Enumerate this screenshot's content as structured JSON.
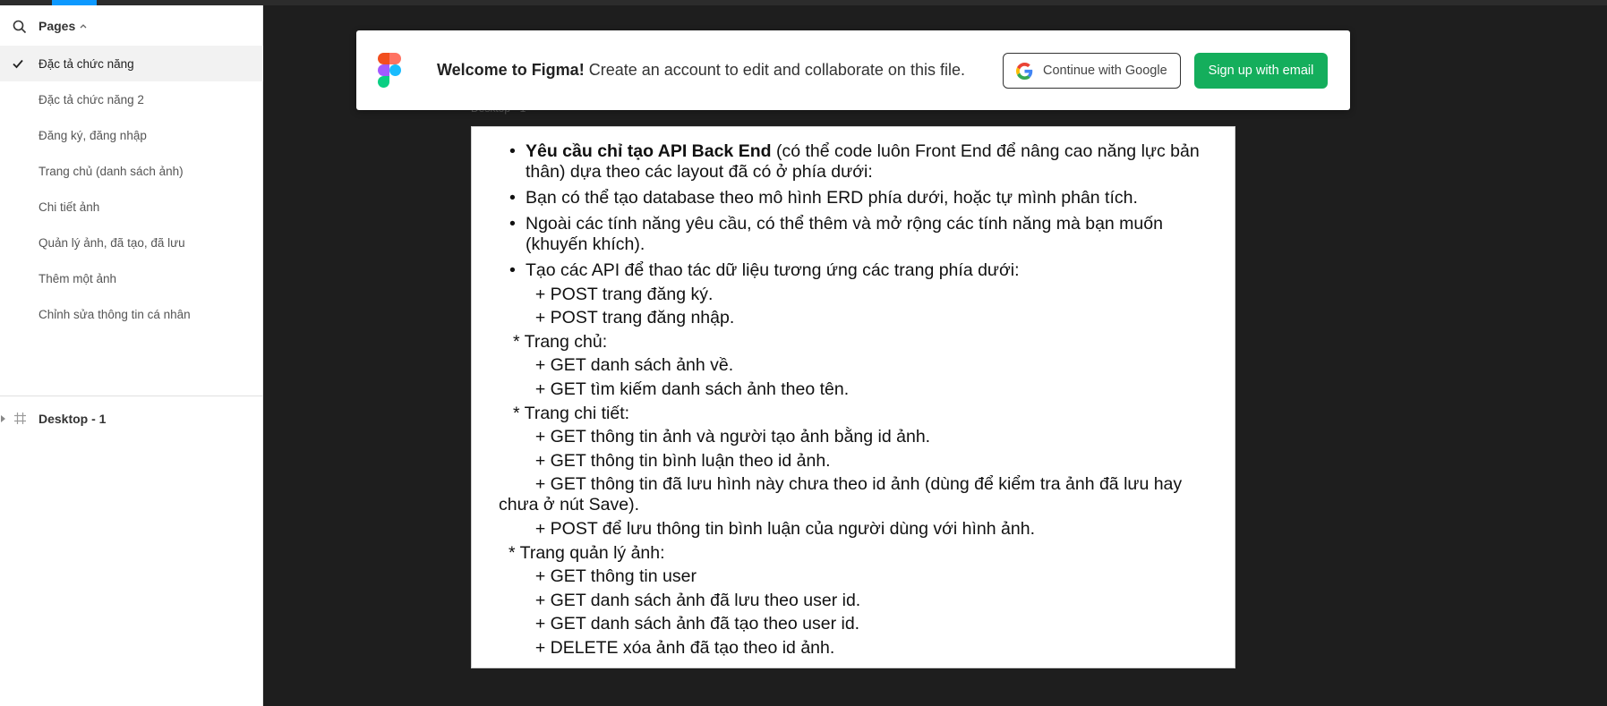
{
  "sidebar": {
    "pages_title": "Pages",
    "pages": [
      {
        "label": "Đặc tả chức năng",
        "active": true
      },
      {
        "label": "Đặc tả chức năng 2",
        "active": false
      },
      {
        "label": "Đăng ký, đăng nhập",
        "active": false
      },
      {
        "label": "Trang chủ (danh sách ảnh)",
        "active": false
      },
      {
        "label": "Chi tiết ảnh",
        "active": false
      },
      {
        "label": "Quản lý ảnh, đã tạo, đã lưu",
        "active": false
      },
      {
        "label": "Thêm một ảnh",
        "active": false
      },
      {
        "label": "Chỉnh sửa thông tin cá nhân",
        "active": false
      }
    ],
    "layers": [
      {
        "label": "Desktop - 1"
      }
    ]
  },
  "canvas": {
    "frame_label": "Desktop - 1"
  },
  "banner": {
    "welcome_bold": "Welcome to Figma!",
    "welcome_rest": " Create an account to edit and collaborate on this file.",
    "google_button": "Continue with Google",
    "signup_button": "Sign up with email"
  },
  "document": {
    "bullet1_bold": "Yêu cầu chỉ tạo API Back End",
    "bullet1_rest": " (có thể code luôn Front End để nâng cao năng lực bản thân) dựa theo các layout đã có ở phía dưới:",
    "bullet2": "Bạn có thể tạo database theo mô hình ERD phía dưới, hoặc tự mình phân tích.",
    "bullet3": "Ngoài các tính năng yêu cầu, có thể thêm và mở rộng các tính năng mà bạn muốn (khuyến khích).",
    "bullet4": "Tạo các API để thao tác dữ liệu tương ứng các trang phía dưới:",
    "lines": [
      "  + POST trang đăng ký.",
      "  + POST trang đăng nhập.",
      "* Trang chủ:",
      "  + GET danh sách ảnh về.",
      "  + GET tìm kiếm danh sách ảnh theo tên.",
      "* Trang chi tiết:",
      "  + GET thông tin ảnh và người tạo ảnh bằng id ảnh.",
      "  + GET thông tin bình luận theo id ảnh.",
      "  + GET thông tin đã lưu hình này chưa theo id ảnh (dùng để kiểm tra ảnh đã lưu hay chưa ở nút Save).",
      "  + POST để lưu thông tin bình luận của người dùng với hình ảnh.",
      "* Trang quản lý ảnh:",
      "  + GET thông tin user",
      "  + GET danh sách ảnh đã lưu theo user id.",
      "  + GET danh sách ảnh đã tạo theo user id.",
      "  + DELETE xóa ảnh đã tạo theo id ảnh."
    ]
  }
}
